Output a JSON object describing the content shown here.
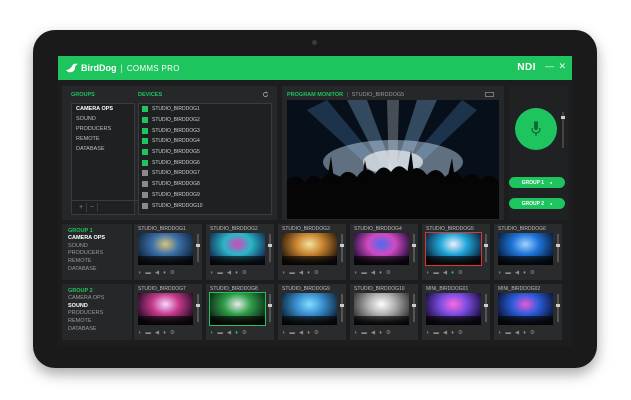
{
  "app": {
    "brand": "BirdDog",
    "title": "COMMS PRO",
    "ndi_logo": "NDI",
    "minimize_glyph": "—",
    "close_glyph": "✕",
    "accent_color": "#1ec45e"
  },
  "groups_panel": {
    "heading": "GROUPS",
    "items": [
      "CAMERA OPS",
      "SOUND",
      "PRODUCERS",
      "REMOTE",
      "DATABASE"
    ],
    "add_label": "+",
    "remove_label": "−"
  },
  "devices_panel": {
    "heading": "DEVICES",
    "refresh_icon": "refresh-icon",
    "items": [
      {
        "name": "STUDIO_BIRDDOG1",
        "active": true
      },
      {
        "name": "STUDIO_BIRDDOG2",
        "active": true
      },
      {
        "name": "STUDIO_BIRDDOG3",
        "active": true
      },
      {
        "name": "STUDIO_BIRDDOG4",
        "active": true
      },
      {
        "name": "STUDIO_BIRDDOG5",
        "active": true
      },
      {
        "name": "STUDIO_BIRDDOG6",
        "active": true
      },
      {
        "name": "STUDIO_BIRDDOG7",
        "active": false
      },
      {
        "name": "STUDIO_BIRDDOG8",
        "active": false
      },
      {
        "name": "STUDIO_BIRDDOG9",
        "active": false
      },
      {
        "name": "STUDIO_BIRDDOG10",
        "active": false
      }
    ]
  },
  "program_monitor": {
    "heading": "PROGRAM MONITOR",
    "source": "STUDIO_BIRDDOG5"
  },
  "talk_panel": {
    "mic_icon": "microphone-icon",
    "group_buttons": [
      "GROUP 1",
      "GROUP 2"
    ]
  },
  "rows": [
    {
      "group_title": "GROUP 1",
      "group_items": [
        {
          "label": "CAMERA OPS",
          "selected": true
        },
        {
          "label": "SOUND",
          "selected": false
        },
        {
          "label": "PRODUCERS",
          "selected": false
        },
        {
          "label": "REMOTE",
          "selected": false
        },
        {
          "label": "DATABASE",
          "selected": false
        }
      ],
      "tiles": [
        {
          "name": "STUDIO_BIRDDOG1",
          "highlight": "none",
          "mic_on": false
        },
        {
          "name": "STUDIO_BIRDDOG2",
          "highlight": "none",
          "mic_on": false
        },
        {
          "name": "STUDIO_BIRDDOG3",
          "highlight": "none",
          "mic_on": false
        },
        {
          "name": "STUDIO_BIRDDOG4",
          "highlight": "none",
          "mic_on": false
        },
        {
          "name": "STUDIO_BIRDDOG5",
          "highlight": "red",
          "mic_on": true
        },
        {
          "name": "STUDIO_BIRDDOG6",
          "highlight": "none",
          "mic_on": false
        }
      ]
    },
    {
      "group_title": "GROUP 2",
      "group_items": [
        {
          "label": "CAMERA OPS",
          "selected": false
        },
        {
          "label": "SOUND",
          "selected": true
        },
        {
          "label": "PRODUCERS",
          "selected": false
        },
        {
          "label": "REMOTE",
          "selected": false
        },
        {
          "label": "DATABASE",
          "selected": false
        }
      ],
      "tiles": [
        {
          "name": "STUDIO_BIRDDOG7",
          "highlight": "none",
          "mic_on": false
        },
        {
          "name": "STUDIO_BIRDDOG8",
          "highlight": "green",
          "mic_on": true
        },
        {
          "name": "STUDIO_BIRDDOG9",
          "highlight": "none",
          "mic_on": false
        },
        {
          "name": "STUDIO_BIRDDOG10",
          "highlight": "none",
          "mic_on": false
        },
        {
          "name": "MINI_BIRDDOG01",
          "highlight": "none",
          "mic_on": false
        },
        {
          "name": "MINI_BIRDDOG02",
          "highlight": "none",
          "mic_on": false
        }
      ]
    }
  ],
  "tile_controls": [
    "headset-icon",
    "camera-icon",
    "speaker-icon",
    "microphone-icon",
    "settings-icon"
  ]
}
